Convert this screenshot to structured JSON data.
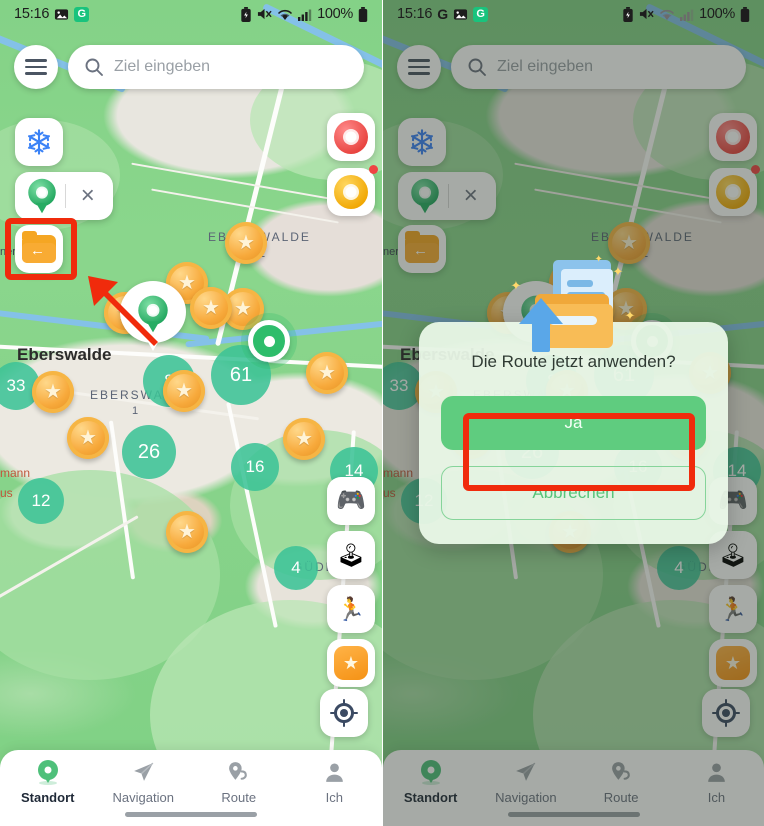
{
  "screen": {
    "left_panel_label": "map-screen-before",
    "right_panel_label": "map-screen-confirm-dialog"
  },
  "status_bar": {
    "time": "15:16",
    "battery_percent": "100%",
    "icons_left": [
      "image-icon",
      "grammarly-g-badge-icon"
    ],
    "icons_left_right_panel": [
      "google-g-icon",
      "image-icon",
      "grammarly-g-badge-icon"
    ],
    "icons_right": [
      "battery-saver-icon",
      "mute-icon",
      "wifi-icon",
      "signal-icon",
      "battery-icon"
    ]
  },
  "search": {
    "placeholder": "Ziel eingeben",
    "menu_icon": "hamburger-menu-icon",
    "search_icon": "search-icon"
  },
  "left_controls": [
    {
      "name": "snowflake-button",
      "icon": "snowflake-icon",
      "label": ""
    },
    {
      "name": "pokestop-filter-pill",
      "icon": "green-pokeball-icon",
      "close_label": "×"
    },
    {
      "name": "route-folder-button",
      "icon": "folder-import-icon",
      "label": ""
    }
  ],
  "right_controls": [
    {
      "name": "red-pokeball-button",
      "icon": "red-pokeball-icon",
      "badge": false
    },
    {
      "name": "gold-pokeball-button",
      "icon": "gold-pokeball-icon",
      "badge": true
    },
    {
      "name": "gamepad-button",
      "icon": "gamepad-icon"
    },
    {
      "name": "joystick-button",
      "icon": "joystick-icon"
    },
    {
      "name": "walk-button",
      "icon": "running-person-icon"
    },
    {
      "name": "favorites-button",
      "icon": "star-badge-icon"
    },
    {
      "name": "locate-me-button",
      "icon": "crosshair-location-icon"
    }
  ],
  "map": {
    "labels": [
      {
        "text": "EBERSWALDE",
        "kind": "district"
      },
      {
        "text": "2",
        "kind": "district-number"
      },
      {
        "text": "Eberswalde",
        "kind": "town"
      },
      {
        "text": "EBERSWALDE",
        "kind": "district"
      },
      {
        "text": "1",
        "kind": "district-number"
      },
      {
        "text": "GÜDEN",
        "kind": "district"
      },
      {
        "text": "ner",
        "kind": "street"
      },
      {
        "text": "mann",
        "kind": "poi"
      },
      {
        "text": "us",
        "kind": "poi"
      }
    ],
    "clusters": [
      {
        "count": "33"
      },
      {
        "count": "8"
      },
      {
        "count": "61"
      },
      {
        "count": "26"
      },
      {
        "count": "16"
      },
      {
        "count": "14"
      },
      {
        "count": "12"
      },
      {
        "count": "4"
      }
    ],
    "pokestop_icon": "star-coin-icon",
    "user_location_icon": "user-location-dot",
    "gym_marker_icon": "gym-teardrop-marker"
  },
  "dialog": {
    "title": "Die Route jetzt anwenden?",
    "confirm_label": "Ja",
    "cancel_label": "Abbrechen",
    "illustration": "folder-import-arrow-illustration"
  },
  "bottom_nav": {
    "items": [
      {
        "label": "Standort",
        "icon": "location-pin-icon",
        "active": true
      },
      {
        "label": "Navigation",
        "icon": "paper-plane-icon",
        "active": false
      },
      {
        "label": "Route",
        "icon": "route-pin-icon",
        "active": false
      },
      {
        "label": "Ich",
        "icon": "person-icon",
        "active": false
      }
    ]
  },
  "annotations": {
    "highlight_color": "#f02b0c",
    "folder_button_highlight": "red-rectangle-highlight",
    "pointer": "red-arrow-pointing-up-left",
    "confirm_button_highlight": "red-rectangle-highlight"
  },
  "colors": {
    "accent_green": "#5fcc7f",
    "cluster_green": "#3cc396",
    "coin_orange": "#f7a93b",
    "highlight_red": "#f02b0c",
    "map_green": "#84d287"
  }
}
